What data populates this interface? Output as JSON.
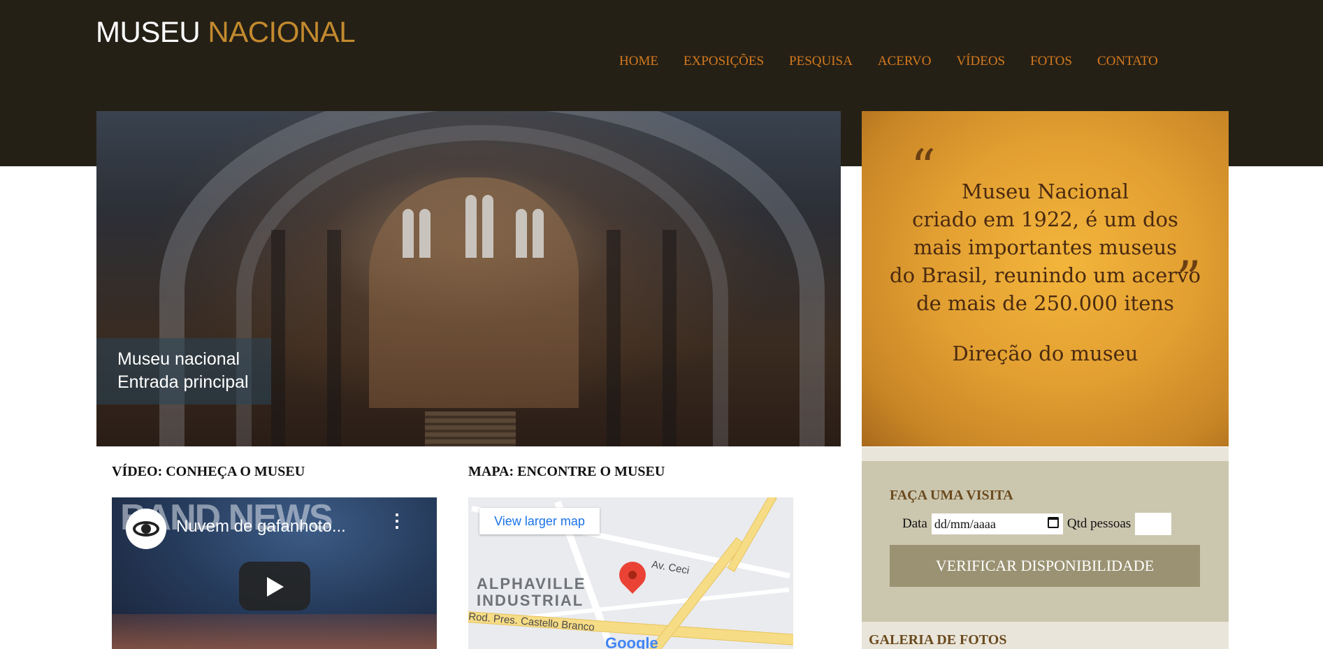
{
  "header": {
    "logo_part1": "MUSEU",
    "logo_part2": "NACIONAL",
    "nav": [
      "HOME",
      "EXPOSIÇÕES",
      "PESQUISA",
      "ACERVO",
      "VÍDEOS",
      "FOTOS",
      "CONTATO"
    ]
  },
  "hero": {
    "caption_line1": "Museu nacional",
    "caption_line2": "Entrada principal"
  },
  "quote": {
    "open": "“",
    "close": "”",
    "lines": [
      "Museu Nacional",
      "criado em 1922, é um dos",
      "mais importantes museus",
      "do Brasil, reunindo um acervo",
      "de mais de 250.000 itens"
    ],
    "signature": "Direção do museu"
  },
  "video_section": {
    "title": "VÍDEO: CONHEÇA O MUSEU",
    "brand": "BAND NEWS",
    "video_title": "Nuvem de gafanhoto...",
    "more_icon": "⋮"
  },
  "map_section": {
    "title": "MAPA: ENCONTRE O MUSEU",
    "larger_map": "View larger map",
    "area_line1": "ALPHAVILLE",
    "area_line2": "INDUSTRIAL",
    "road1": "Av. Ceci",
    "road2": "Rod. Pres. Castello Branco",
    "google": "Google"
  },
  "visit": {
    "title": "FAÇA UMA VISITA",
    "date_label": "Data",
    "date_placeholder": "dd/mm/aaaa",
    "qty_label": "Qtd pessoas",
    "button": "VERIFICAR DISPONIBILIDADE"
  },
  "gallery": {
    "title": "GALERIA DE FOTOS"
  },
  "colors": {
    "header_bg": "#252016",
    "nav": "#d57a1e",
    "accent": "#c38a2e",
    "visit_bg": "#cbc6ae",
    "visit_button": "#9a9272"
  }
}
